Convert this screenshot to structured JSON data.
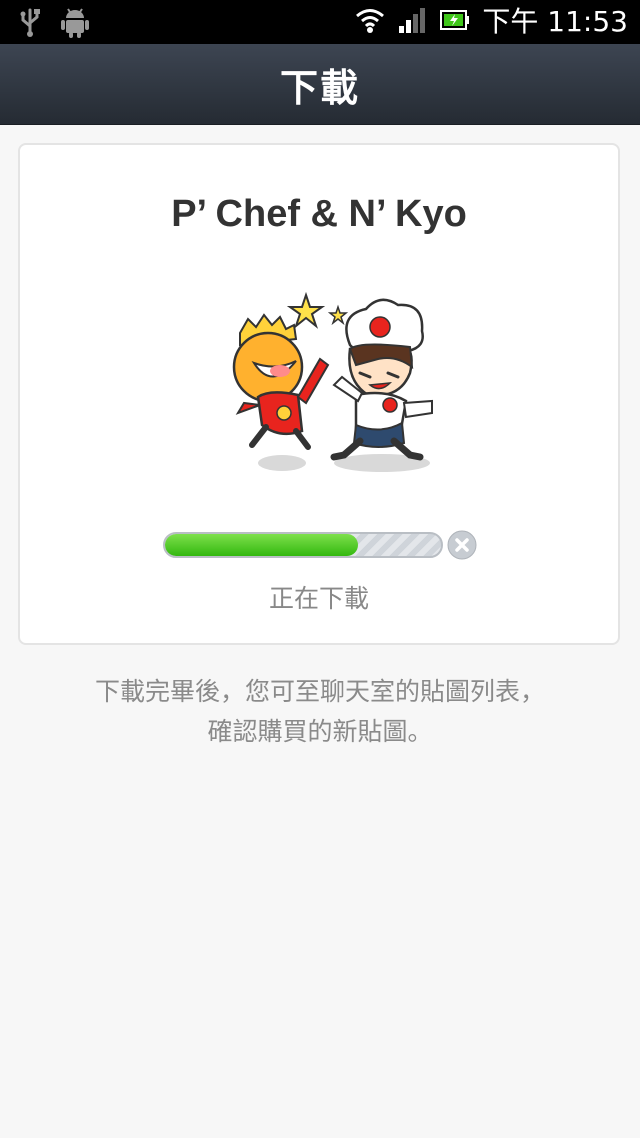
{
  "status_bar": {
    "time": "下午 11:53",
    "icons": [
      "usb-icon",
      "android-icon",
      "wifi-icon",
      "signal-icon",
      "battery-charging-icon"
    ]
  },
  "header": {
    "title": "下載"
  },
  "download": {
    "sticker_name": "P’ Chef & N’ Kyo",
    "progress_fraction": 0.7,
    "status_text": "正在下載"
  },
  "info": {
    "line1": "下載完畢後，您可至聊天室的貼圖列表，",
    "line2": "確認購買的新貼圖。"
  },
  "colors": {
    "progress": "#3fc61a",
    "header": "#2f353e",
    "text_gray": "#8a8a8a"
  }
}
